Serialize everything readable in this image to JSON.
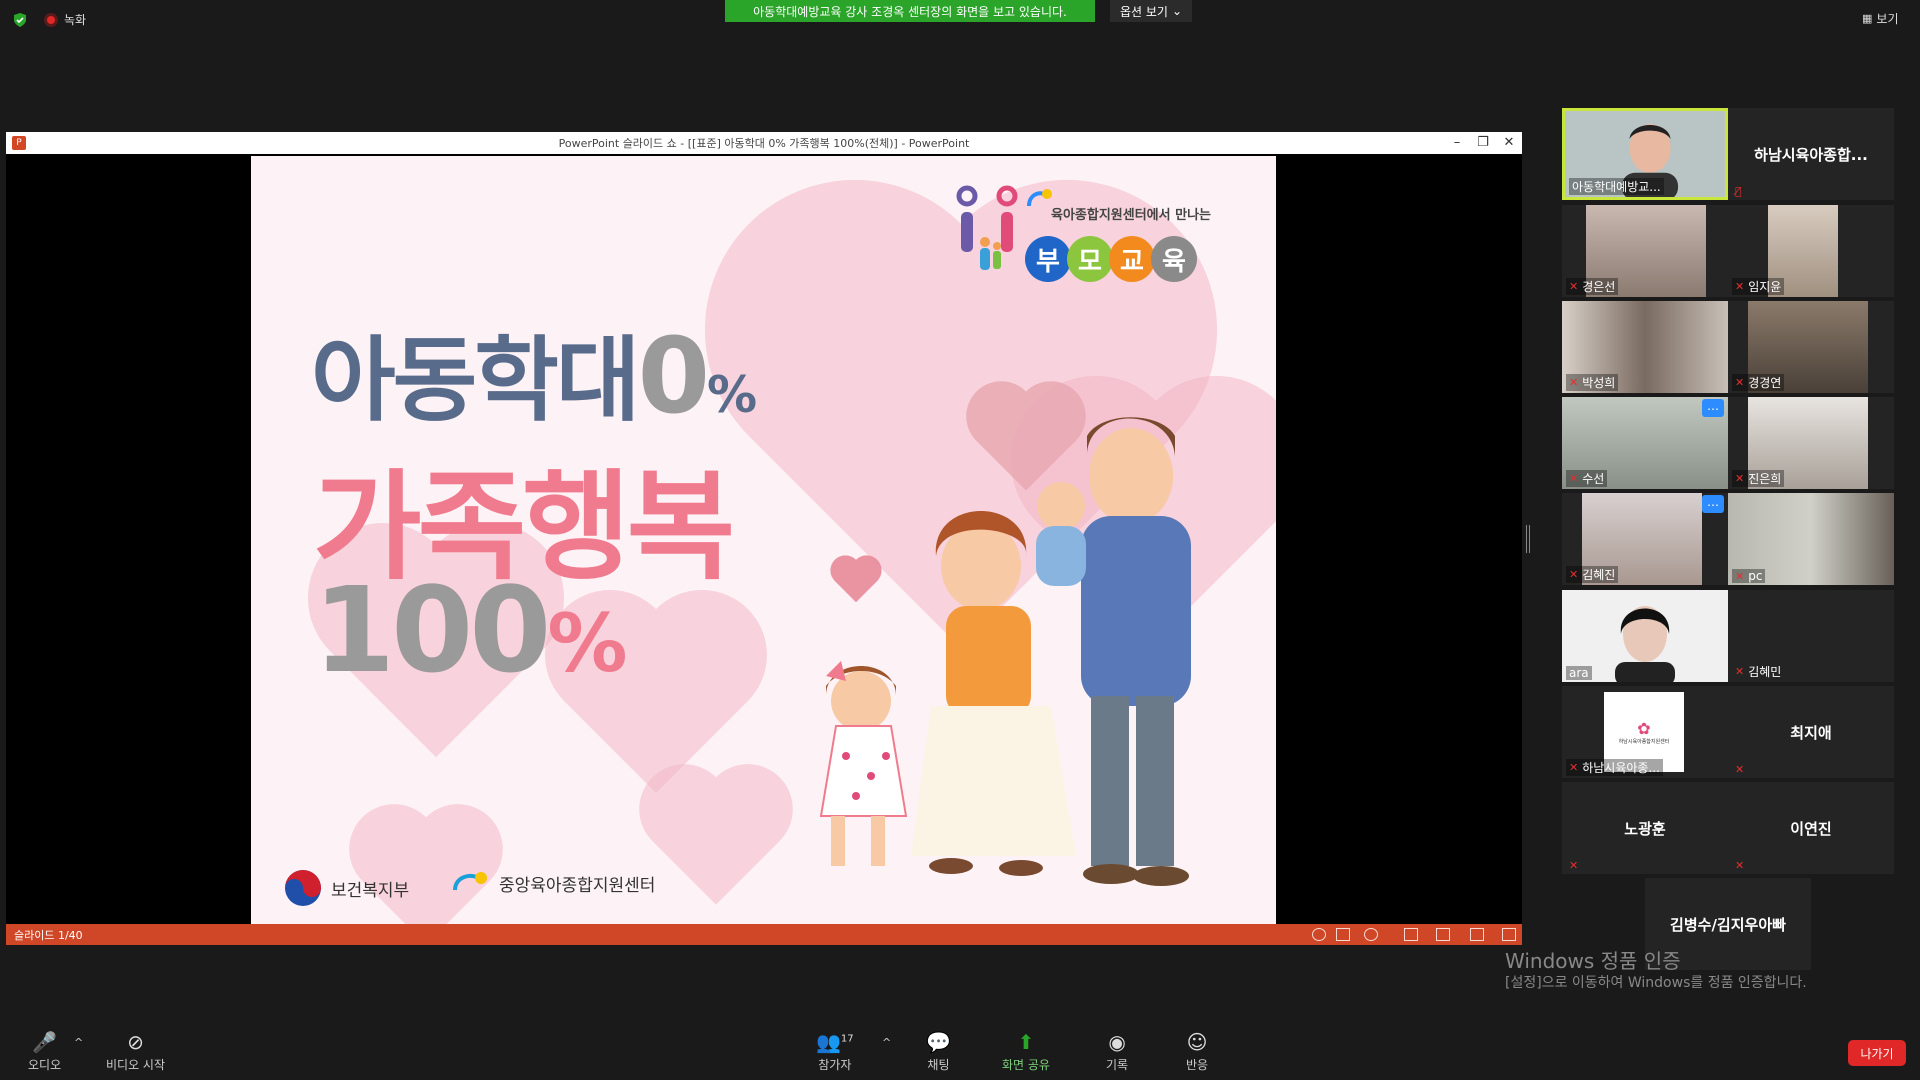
{
  "top": {
    "recording_label": "녹화",
    "banner": "아동학대예방교육 강사 조경옥 센터장의 화면을 보고 있습니다.",
    "options_label": "옵션 보기",
    "view_label": "보기"
  },
  "ppt": {
    "title": "PowerPoint 슬라이드 쇼 - [[표준] 아동학대 0% 가족행복 100%(전체)] - PowerPoint",
    "slide_status": "슬라이드 1/40",
    "slide": {
      "logo_caption": "육아종합지원센터에서 만나는",
      "bubbles": [
        "부",
        "모",
        "교",
        "육"
      ],
      "line1": "아동학대",
      "line1_zero": "0",
      "line1_pct": "%",
      "line2": "가족행복",
      "line3": "100",
      "line3_pct": "%",
      "footer_ministry": "보건복지부",
      "footer_center": "중앙육아종합지원센터"
    }
  },
  "gallery": {
    "tiles": [
      {
        "name": "아동학대예방교..."
      },
      {
        "name": "하남시육아종합..."
      },
      {
        "name": "경은선"
      },
      {
        "name": "임지윤"
      },
      {
        "name": "박성희"
      },
      {
        "name": "경경연"
      },
      {
        "name": "수선"
      },
      {
        "name": "진은희"
      },
      {
        "name": "김혜진"
      },
      {
        "name": "pc"
      },
      {
        "name": "ara"
      },
      {
        "name": "김혜민"
      },
      {
        "name": "하남시육아종..."
      },
      {
        "name": "최지애"
      },
      {
        "name": "노광훈"
      },
      {
        "name": "이연진"
      },
      {
        "name": "김병수/김지우아빠"
      }
    ],
    "mini_logo_text": "하남시육아종합지원센터"
  },
  "watermark": {
    "line1": "Windows 정품 인증",
    "line2": "[설정]으로 이동하여 Windows를 정품 인증합니다."
  },
  "toolbar": {
    "audio": "오디오",
    "video": "비디오 시작",
    "participants": "참가자",
    "participants_count": "17",
    "chat": "채팅",
    "share": "화면 공유",
    "record": "기록",
    "reactions": "반응",
    "leave": "나가기"
  },
  "colors": {
    "banner_green": "#2aa52a",
    "ppt_status": "#d04727",
    "leave_red": "#e02828",
    "active_speaker": "#c8e63c",
    "accent_blue": "#2d8cff"
  }
}
